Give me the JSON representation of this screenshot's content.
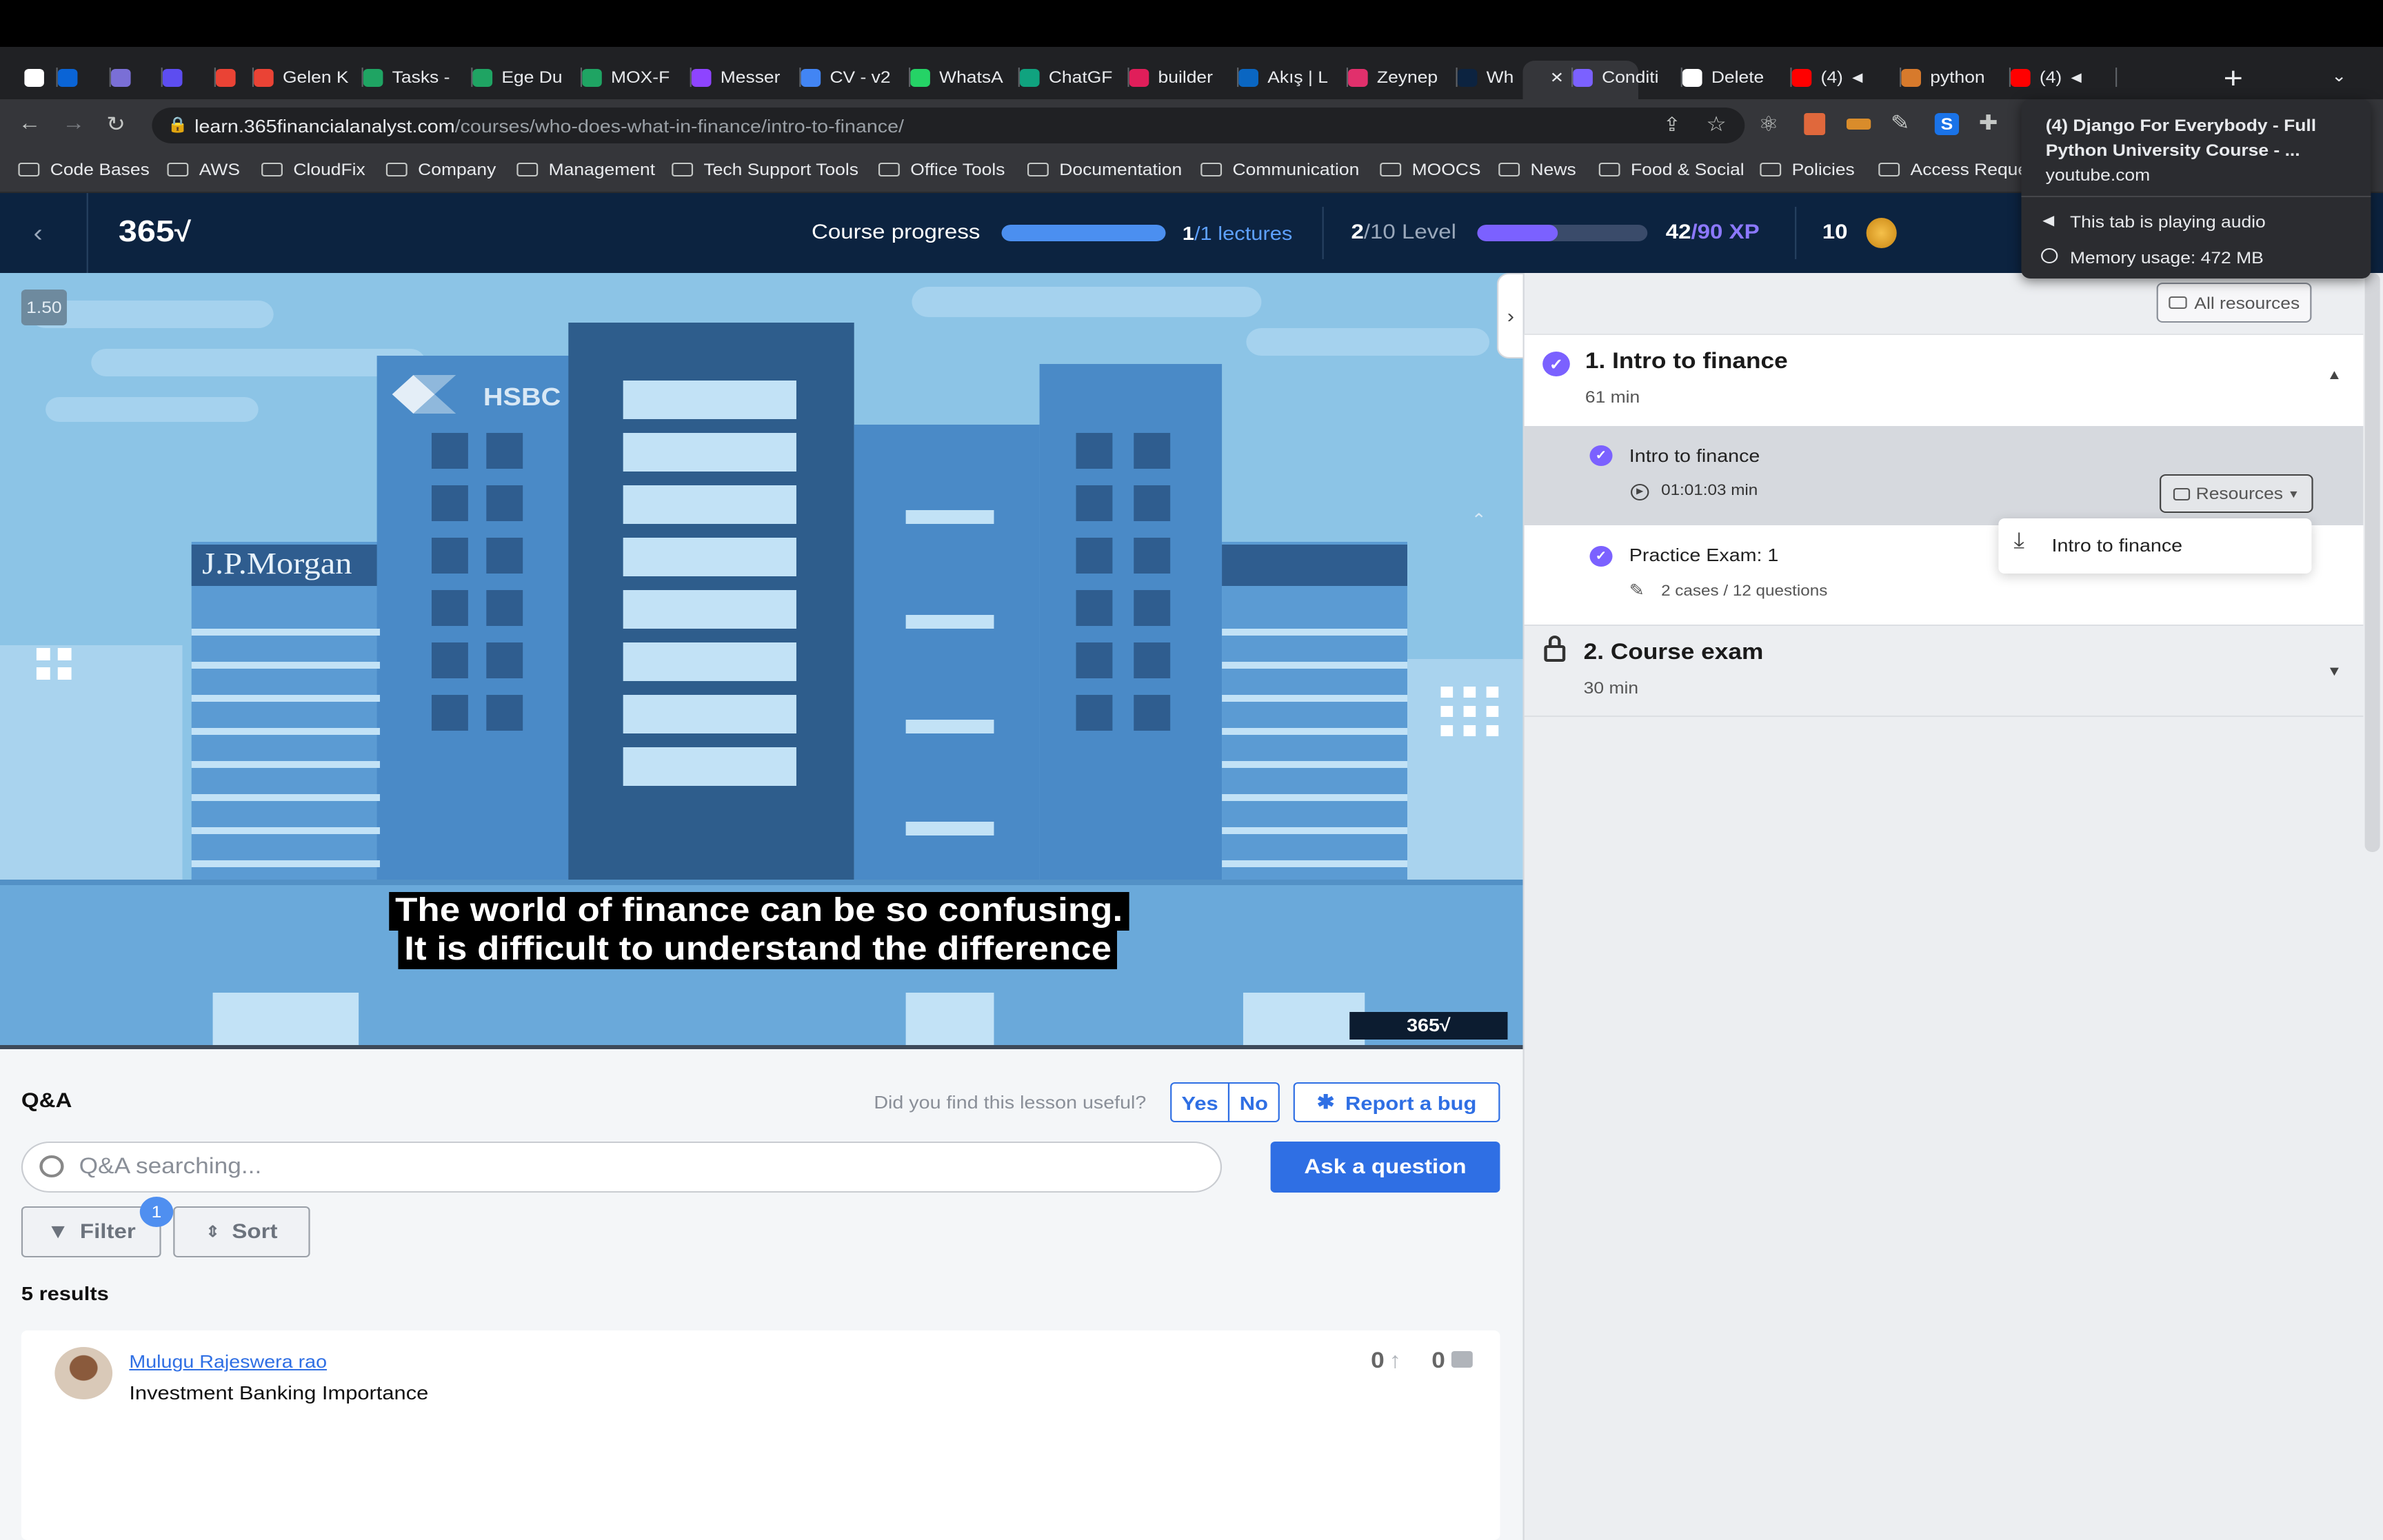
{
  "browser": {
    "tabs": [
      {
        "label": "",
        "color": "#ffffff"
      },
      {
        "label": "",
        "color": "#0a64d6"
      },
      {
        "label": "",
        "color": "#7a6fd6"
      },
      {
        "label": "",
        "color": "#5d4df0"
      },
      {
        "label": "",
        "color": "#ea4335"
      },
      {
        "label": "Gelen K",
        "color": "#ea4335"
      },
      {
        "label": "Tasks -",
        "color": "#1fa463"
      },
      {
        "label": "Ege Du",
        "color": "#1fa463"
      },
      {
        "label": "MOX-F",
        "color": "#1fa463"
      },
      {
        "label": "Messer",
        "color": "#8e44ff"
      },
      {
        "label": "CV - v2",
        "color": "#4285f4"
      },
      {
        "label": "WhatsA",
        "color": "#25d366"
      },
      {
        "label": "ChatGF",
        "color": "#10a37f"
      },
      {
        "label": "builder",
        "color": "#e01e5a"
      },
      {
        "label": "Akış | L",
        "color": "#0a66c2"
      },
      {
        "label": "Zeynep",
        "color": "#e1306c"
      },
      {
        "label": "Wh",
        "color": "#0c2340"
      },
      {
        "label": "Conditi",
        "color": "#7b61ff"
      },
      {
        "label": "Delete",
        "color": "#ffffff"
      },
      {
        "label": "(4)",
        "color": "#ff0000"
      },
      {
        "label": "python",
        "color": "#d77a2c"
      },
      {
        "label": "(4)",
        "color": "#ff0000"
      }
    ],
    "new_tab": "+",
    "url_host": "learn.365financialanalyst.com",
    "url_path": "/courses/who-does-what-in-finance/intro-to-finance/",
    "bookmarks": [
      "Code Bases",
      "AWS",
      "CloudFix",
      "Company",
      "Management",
      "Tech Support Tools",
      "Office Tools",
      "Documentation",
      "Communication",
      "MOOCS",
      "News",
      "Food & Social",
      "Policies",
      "Access Reque"
    ],
    "tab_popup": {
      "title": "(4) Django For Everybody - Full Python University Course - ...",
      "domain": "youtube.com",
      "audio": "This tab is playing audio",
      "memory": "Memory usage: 472 MB"
    }
  },
  "header": {
    "logo": "365",
    "progress_label": "Course progress",
    "lectures_done": "1",
    "lectures_total": "/1 lectures",
    "progress_fraction": 1.0,
    "level_current": "2",
    "level_total": "/10 Level",
    "xp_current": "42",
    "xp_total": "/90 XP",
    "xp_fraction": 0.47,
    "coins": "10"
  },
  "video": {
    "speed": "1.50",
    "subtitle_line1": "The world of finance can be so confusing.",
    "subtitle_line2": "It is difficult to understand the difference",
    "building_left_text": "J.P.Morgan",
    "building_center_text": "HSBC",
    "watermark": "365"
  },
  "sidebar": {
    "all_resources": "All resources",
    "sections": [
      {
        "title": "1. Intro to finance",
        "duration": "61 min"
      },
      {
        "title": "2. Course exam",
        "duration": "30 min"
      }
    ],
    "items": [
      {
        "title": "Intro to finance",
        "meta": "01:01:03 min",
        "button": "Resources"
      },
      {
        "title": "Practice Exam: 1",
        "meta": "2 cases / 12 questions"
      }
    ],
    "dropdown_item": "Intro to finance"
  },
  "qa": {
    "title": "Q&A",
    "useful_question": "Did you find this lesson useful?",
    "yes": "Yes",
    "no": "No",
    "report_bug": "Report a bug",
    "search_placeholder": "Q&A searching...",
    "ask": "Ask a question",
    "filter": "Filter",
    "filter_badge": "1",
    "sort": "Sort",
    "results": "5 results",
    "question": {
      "author": "Mulugu Rajeswera rao",
      "title": "Investment Banking Importance",
      "upvotes": "0",
      "comments": "0"
    }
  }
}
